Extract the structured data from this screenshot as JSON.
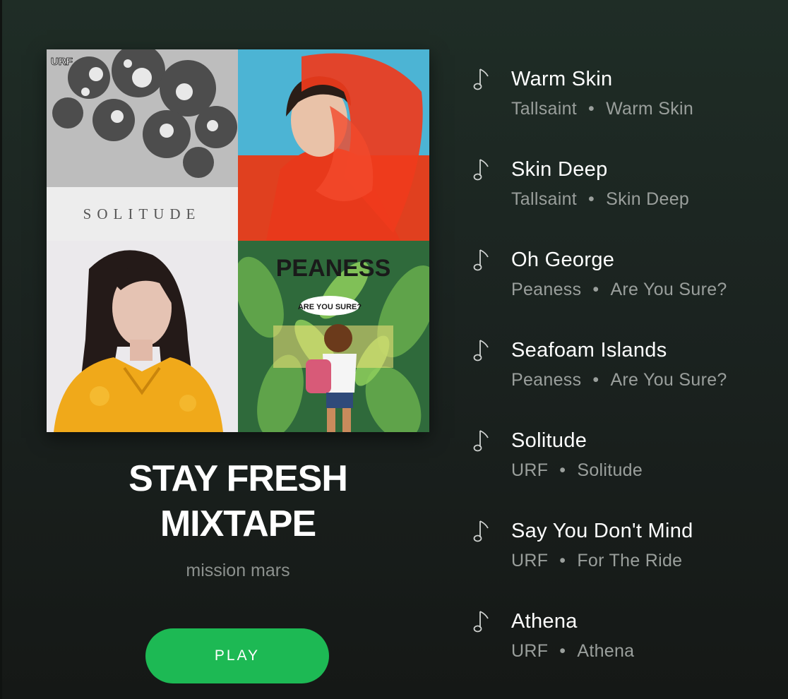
{
  "playlist": {
    "title_line1": "STAY FRESH",
    "title_line2": "MIXTAPE",
    "owner": "mission mars",
    "play_label": "PLAY",
    "accent_color": "#1db954"
  },
  "collage": {
    "tiles": [
      {
        "name": "Solitude album art",
        "text": "SOLITUDE",
        "logo": "URF"
      },
      {
        "name": "Tallsaint album art"
      },
      {
        "name": "Tallsaint portrait art"
      },
      {
        "name": "Peaness album art",
        "text": "PEANESS",
        "subtitle": "ARE YOU SURE?"
      }
    ]
  },
  "tracks": [
    {
      "title": "Warm Skin",
      "artist": "Tallsaint",
      "album": "Warm Skin",
      "icon": "music-note-icon"
    },
    {
      "title": "Skin Deep",
      "artist": "Tallsaint",
      "album": "Skin Deep",
      "icon": "music-note-icon"
    },
    {
      "title": "Oh George",
      "artist": "Peaness",
      "album": "Are You Sure?",
      "icon": "music-note-icon"
    },
    {
      "title": "Seafoam Islands",
      "artist": "Peaness",
      "album": "Are You Sure?",
      "icon": "music-note-icon"
    },
    {
      "title": "Solitude",
      "artist": "URF",
      "album": "Solitude",
      "icon": "music-note-icon"
    },
    {
      "title": "Say You Don't Mind",
      "artist": "URF",
      "album": "For The Ride",
      "icon": "music-note-icon"
    },
    {
      "title": "Athena",
      "artist": "URF",
      "album": "Athena",
      "icon": "music-note-icon"
    }
  ],
  "separator": "•"
}
